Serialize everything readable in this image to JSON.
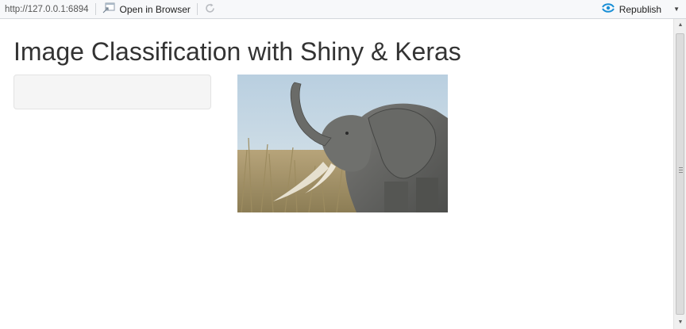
{
  "toolbar": {
    "url": "http://127.0.0.1:6894",
    "open_in_browser_label": "Open in Browser",
    "refresh_icon": "refresh-icon",
    "republish_label": "Republish",
    "republish_icon_color": "#1a8fd6"
  },
  "page": {
    "title": "Image Classification with Shiny & Keras",
    "image_description": "elephant"
  },
  "scrollbar": {
    "up_icon": "scroll-up-arrow-icon",
    "down_icon": "scroll-down-arrow-icon"
  }
}
